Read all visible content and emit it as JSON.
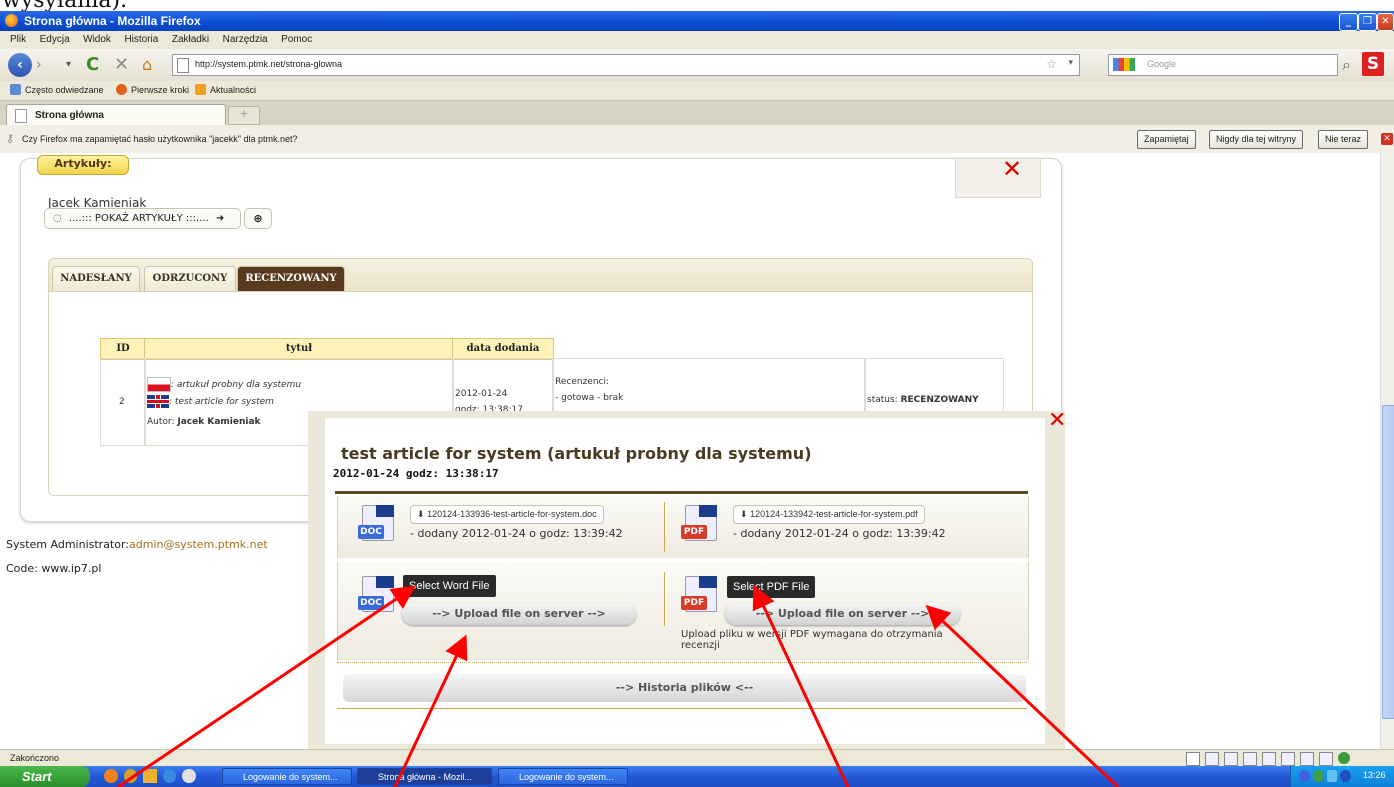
{
  "overlay_text": "wysyłania).",
  "window": {
    "title": "Strona główna - Mozilla Firefox"
  },
  "menu": [
    "Plik",
    "Edycja",
    "Widok",
    "Historia",
    "Zakładki",
    "Narzędzia",
    "Pomoc"
  ],
  "nav": {
    "url": "http://system.ptmk.net/strona-glowna",
    "search_placeholder": "Google"
  },
  "bookmarks": [
    "Często odwiedzane",
    "Pierwsze kroki",
    "Aktualności"
  ],
  "tab": {
    "label": "Strona główna",
    "new_tab": "+"
  },
  "password_bar": {
    "text": "Czy Firefox ma zapamiętać hasło użytkownika \"jacekk\" dla ptmk.net?",
    "buttons": [
      "Zapamiętaj",
      "Nigdy dla tej witryny",
      "Nie teraz"
    ]
  },
  "articles": {
    "label": "Artykuły:",
    "author": "Jacek Kamieniak",
    "show_button": "....::: POKAŻ ARTYKUŁY :::....",
    "tabs": [
      "NADESŁANY",
      "ODRZUCONY",
      "RECENZOWANY"
    ],
    "table": {
      "headers": [
        "ID",
        "tytuł",
        "data dodania"
      ],
      "row": {
        "id": "2",
        "title_pl": ": artukuł probny dla systemu",
        "title_en": ": test article for system",
        "author_label": "Autor:",
        "author": "Jacek Kamieniak",
        "date": "2012-01-24",
        "time": "godz: 13:38:17",
        "reviewers_label": "Recenzenci:",
        "reviewers_value": "- gotowa - brak",
        "status_label": "status:",
        "status": "RECENZOWANY"
      }
    }
  },
  "footer": {
    "admin_label": "System Administrator:",
    "admin_email": "admin@system.ptmk.net",
    "code": "Code: www.ip7.pl"
  },
  "modal": {
    "title": "test article for system (artukuł probny dla systemu)",
    "date": "2012-01-24 godz: 13:38:17",
    "doc_file": "120124-133936-test-article-for-system.doc",
    "doc_added": "- dodany 2012-01-24 o godz: 13:39:42",
    "pdf_file": "120124-133942-test-article-for-system.pdf",
    "pdf_added": "- dodany 2012-01-24 o godz: 13:39:42",
    "select_word": "Select Word File",
    "select_pdf": "Select PDF File",
    "upload_label": "--> Upload file on server -->",
    "pdf_note": "Upload pliku w wersji PDF wymagana do otrzymania recenzji",
    "history": "--> Historia plików <--",
    "doc_icon_label": "DOC",
    "pdf_icon_label": "PDF"
  },
  "status_bar": {
    "text": "Zakończono"
  },
  "taskbar": {
    "start": "Start",
    "tasks": [
      "Logowanie do system...",
      "Strona główna - Mozil...",
      "Logowanie do system..."
    ],
    "clock": "13:26"
  },
  "colors": {
    "accent_red": "#e00000",
    "title_brown": "#4a3a20",
    "tab_active": "#5a3a1e",
    "header_yellow": "#fff2b8"
  }
}
